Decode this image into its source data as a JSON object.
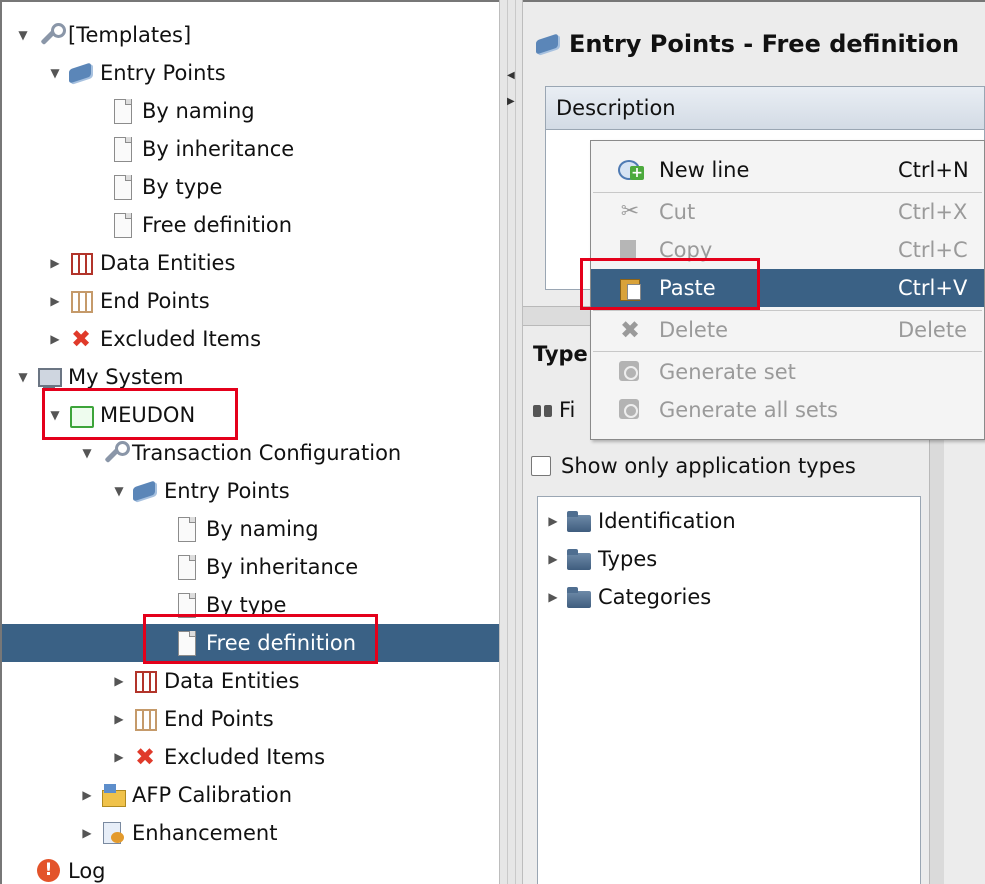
{
  "tree": {
    "templates": "[Templates]",
    "templates_entry_points": "Entry Points",
    "templates_by_naming": "By naming",
    "templates_by_inheritance": "By inheritance",
    "templates_by_type": "By type",
    "templates_free_definition": "Free definition",
    "templates_data_entities": "Data Entities",
    "templates_end_points": "End Points",
    "templates_excluded_items": "Excluded Items",
    "my_system": "My System",
    "meudon": "MEUDON",
    "transaction_configuration": "Transaction Configuration",
    "tc_entry_points": "Entry Points",
    "tc_by_naming": "By naming",
    "tc_by_inheritance": "By inheritance",
    "tc_by_type": "By type",
    "tc_free_definition": "Free definition",
    "tc_data_entities": "Data Entities",
    "tc_end_points": "End Points",
    "tc_excluded_items": "Excluded Items",
    "afp_calibration": "AFP Calibration",
    "enhancement": "Enhancement",
    "log": "Log"
  },
  "panel": {
    "title": "Entry Points - Free definition",
    "description_header": "Description",
    "types_label": "Type",
    "find_label": "Fi",
    "show_only_label": "Show only application types",
    "type_tree": [
      "Identification",
      "Types",
      "Categories"
    ]
  },
  "context_menu": {
    "new_line": "New line",
    "new_line_key": "Ctrl+N",
    "cut": "Cut",
    "cut_key": "Ctrl+X",
    "copy": "Copy",
    "copy_key": "Ctrl+C",
    "paste": "Paste",
    "paste_key": "Ctrl+V",
    "delete": "Delete",
    "delete_key": "Delete",
    "generate_set": "Generate set",
    "generate_all_sets": "Generate all sets"
  },
  "colors": {
    "selection": "#3a6185",
    "highlight_box": "#e4001b"
  }
}
